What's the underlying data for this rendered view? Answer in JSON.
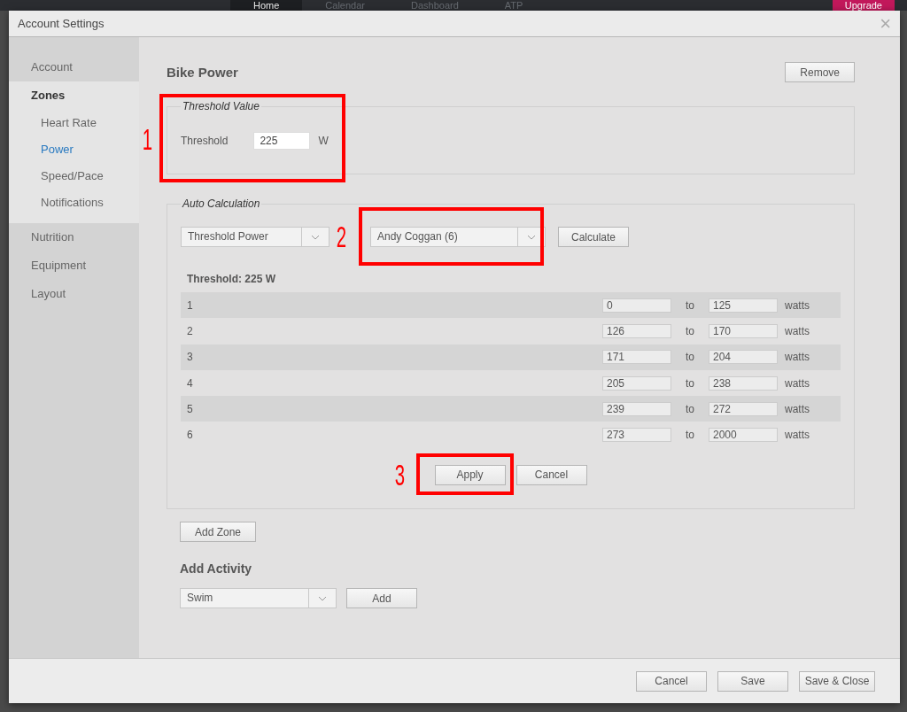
{
  "background_nav": [
    {
      "label": "Home",
      "selected": true
    },
    {
      "label": "Calendar",
      "selected": false
    },
    {
      "label": "Dashboard",
      "selected": false
    },
    {
      "label": "ATP",
      "selected": false
    }
  ],
  "upgrade_button": "Upgrade",
  "dialog": {
    "title": "Account Settings",
    "close": "×"
  },
  "sidebar": {
    "items": [
      {
        "label": "Account",
        "selected": false
      },
      {
        "label": "Zones",
        "selected": true,
        "children": [
          {
            "label": "Heart Rate",
            "selected": false
          },
          {
            "label": "Power",
            "selected": true
          },
          {
            "label": "Speed/Pace",
            "selected": false
          },
          {
            "label": "Notifications",
            "selected": false
          }
        ]
      },
      {
        "label": "Nutrition",
        "selected": false
      },
      {
        "label": "Equipment",
        "selected": false
      },
      {
        "label": "Layout",
        "selected": false
      }
    ]
  },
  "section": {
    "title": "Bike Power",
    "remove_button": "Remove"
  },
  "threshold_value": {
    "legend": "Threshold Value",
    "label": "Threshold",
    "value": "225",
    "unit": "W"
  },
  "auto_calculation": {
    "legend": "Auto Calculation",
    "method": "Threshold Power",
    "model": "Andy Coggan (6)",
    "calculate_button": "Calculate",
    "summary": "Threshold: 225 W",
    "zones": [
      {
        "zone": "1",
        "from": "0",
        "to_label": "to",
        "to": "125",
        "unit": "watts"
      },
      {
        "zone": "2",
        "from": "126",
        "to_label": "to",
        "to": "170",
        "unit": "watts"
      },
      {
        "zone": "3",
        "from": "171",
        "to_label": "to",
        "to": "204",
        "unit": "watts"
      },
      {
        "zone": "4",
        "from": "205",
        "to_label": "to",
        "to": "238",
        "unit": "watts"
      },
      {
        "zone": "5",
        "from": "239",
        "to_label": "to",
        "to": "272",
        "unit": "watts"
      },
      {
        "zone": "6",
        "from": "273",
        "to_label": "to",
        "to": "2000",
        "unit": "watts"
      }
    ],
    "apply_button": "Apply",
    "cancel_button": "Cancel"
  },
  "add_zone_button": "Add Zone",
  "add_activity": {
    "title": "Add Activity",
    "activity": "Swim",
    "add_button": "Add"
  },
  "footer_buttons": [
    "Cancel",
    "Save",
    "Save & Close"
  ],
  "annotations": [
    {
      "label": "1"
    },
    {
      "label": "2"
    },
    {
      "label": "3"
    }
  ]
}
